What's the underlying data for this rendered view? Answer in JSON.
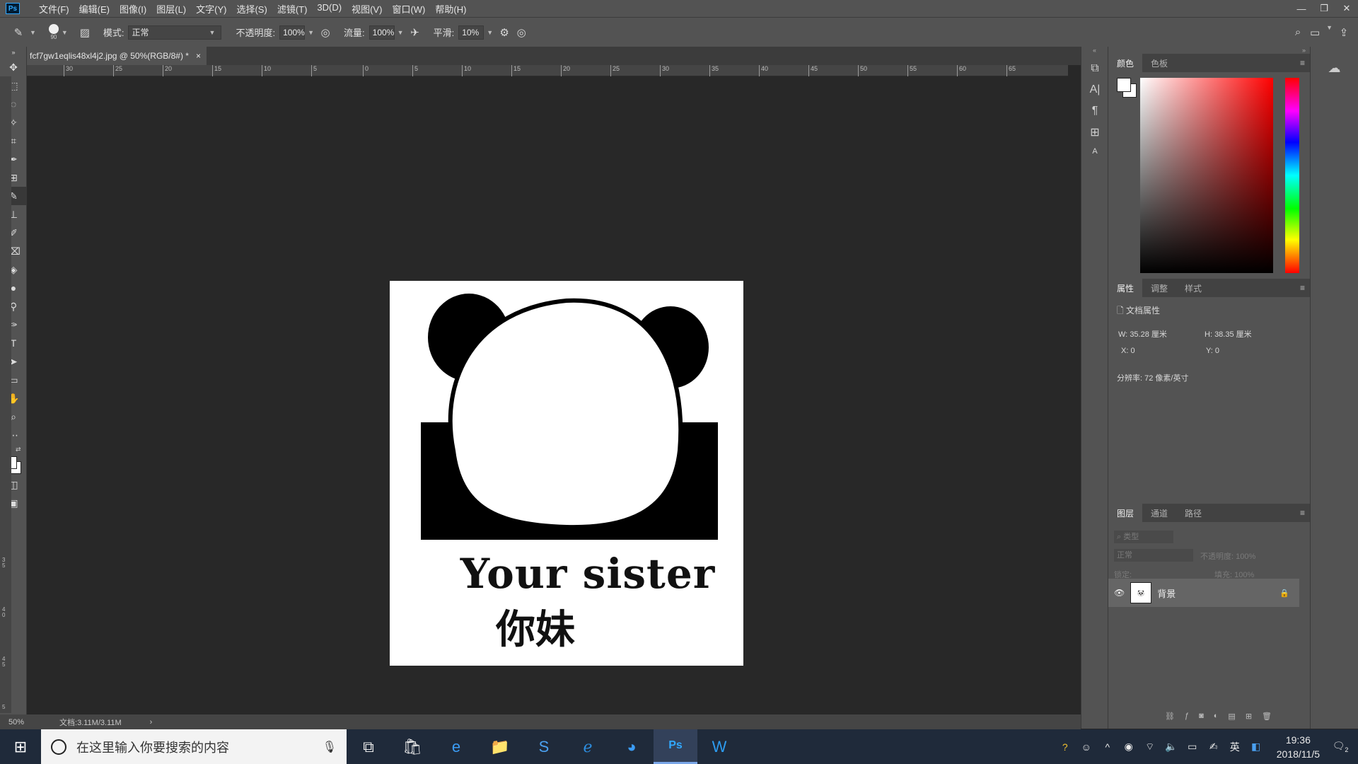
{
  "menubar": {
    "logo": "Ps",
    "items": [
      "文件(F)",
      "编辑(E)",
      "图像(I)",
      "图层(L)",
      "文字(Y)",
      "选择(S)",
      "滤镜(T)",
      "3D(D)",
      "视图(V)",
      "窗口(W)",
      "帮助(H)"
    ],
    "controls": [
      "—",
      "❐",
      "✕"
    ]
  },
  "options": {
    "brush_size": "90",
    "mode_label": "模式:",
    "mode_value": "正常",
    "opacity_label": "不透明度:",
    "opacity_value": "100%",
    "flow_label": "流量:",
    "flow_value": "100%",
    "smooth_label": "平滑:",
    "smooth_value": "10%"
  },
  "document": {
    "tab_title": "fcf7gw1eqlis48xl4j2.jpg @ 50%(RGB/8#) *",
    "tab_close": "×",
    "caption_en": "Your sister",
    "caption_cn": "你妹"
  },
  "ruler": {
    "h_ticks": [
      "30",
      "25",
      "20",
      "15",
      "10",
      "5",
      "0",
      "5",
      "10",
      "15",
      "20",
      "25",
      "30",
      "35",
      "40",
      "45",
      "50",
      "55",
      "60",
      "65"
    ],
    "v_ticks": [
      "3\n5",
      "4\n0",
      "4\n5",
      "5"
    ]
  },
  "status": {
    "zoom": "50%",
    "doc_size": "文档:3.11M/3.11M",
    "arrow": "›"
  },
  "color_panel": {
    "tabs": [
      "颜色",
      "色板"
    ]
  },
  "properties_panel": {
    "tabs": [
      "属性",
      "调整",
      "样式"
    ],
    "title": "文档属性",
    "w_label": "W:",
    "w_value": "35.28 厘米",
    "h_label": "H:",
    "h_value": "38.35 厘米",
    "x_label": "X:",
    "x_value": "0",
    "y_label": "Y:",
    "y_value": "0",
    "resolution": "分辨率: 72 像素/英寸"
  },
  "layers_panel": {
    "tabs": [
      "图层",
      "通道",
      "路径"
    ],
    "filter_placeholder": "类型",
    "blend_mode": "正常",
    "opacity_label": "不透明度:",
    "opacity_value": "100%",
    "lock_label": "锁定:",
    "fill_label": "填充:",
    "fill_value": "100%",
    "layer_name": "背景"
  },
  "taskbar": {
    "search_placeholder": "在这里输入你要搜索的内容",
    "clock_time": "19:36",
    "clock_date": "2018/11/5",
    "ime": "英",
    "notification_count": "2"
  },
  "colors": {
    "accent": "#31a8ff",
    "panel": "#535353",
    "canvas": "#282828"
  }
}
